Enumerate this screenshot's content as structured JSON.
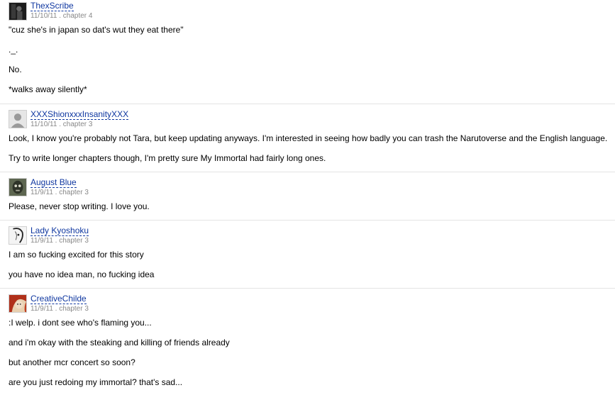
{
  "reviews": [
    {
      "author": "ThexScribe",
      "meta": "11/10/11 . chapter 4",
      "avatar": "dark-figure-avatar",
      "lines": [
        "\"cuz she's in japan so dat's wut they eat there\"",
        "._.",
        "No.",
        "*walks away silently*"
      ]
    },
    {
      "author": "XXXShionxxxInsanityXXX",
      "meta": "11/10/11 . chapter 3",
      "avatar": "default-user-avatar",
      "lines": [
        "Look, I know you're probably not Tara, but keep updating anyways. I'm interested in seeing how badly you can trash the Narutoverse and the English language.",
        "Try to write longer chapters though, I'm pretty sure My Immortal had fairly long ones."
      ]
    },
    {
      "author": "August Blue",
      "meta": "11/9/11 . chapter 3",
      "avatar": "mask-face-avatar",
      "lines": [
        "Please, never stop writing. I love you."
      ]
    },
    {
      "author": "Lady Kyoshoku",
      "meta": "11/9/11 . chapter 3",
      "avatar": "sketch-portrait-avatar",
      "lines": [
        "I am so fucking excited for this story",
        "you have no idea man, no fucking idea"
      ]
    },
    {
      "author": "CreativeChilde",
      "meta": "11/9/11 . chapter 3",
      "avatar": "red-hair-avatar",
      "lines": [
        ":I welp. i dont see who's flaming you...",
        "and i'm okay with the steaking and killing of friends already",
        "but another mcr concert so soon?",
        "are you just redoing my immortal? that's sad..."
      ]
    }
  ]
}
